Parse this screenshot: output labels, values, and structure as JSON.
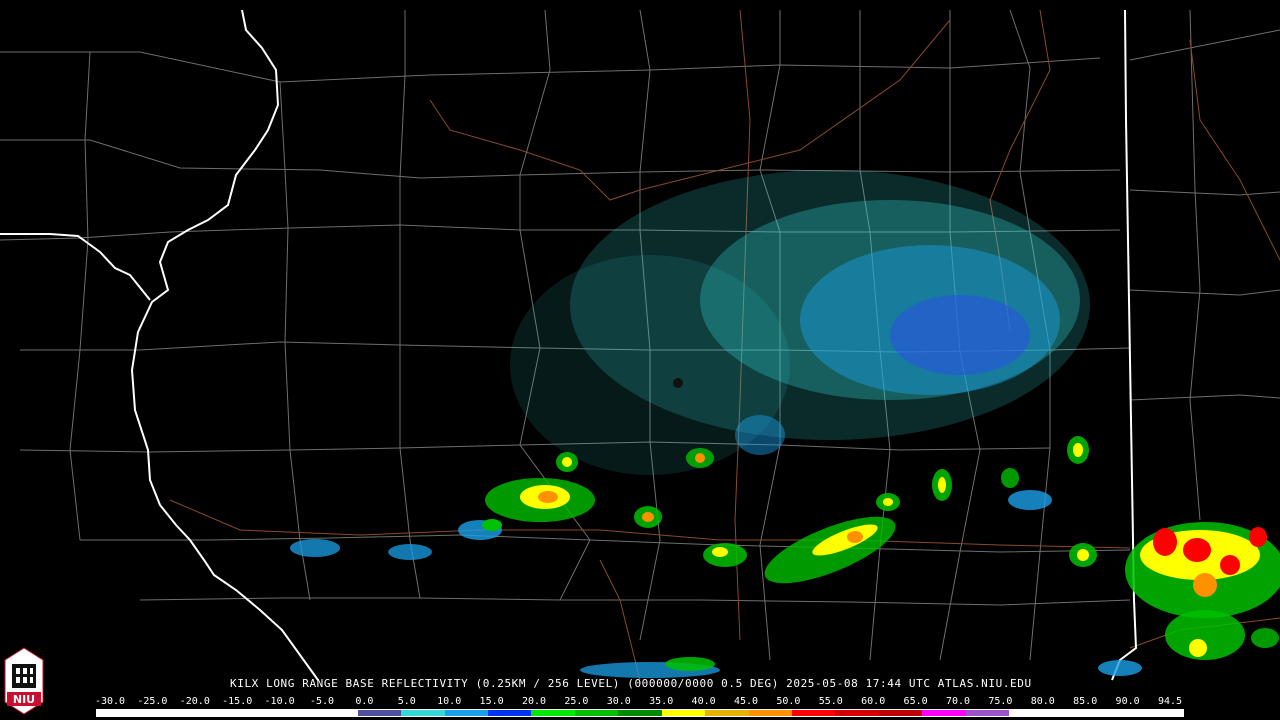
{
  "product": {
    "caption": "KILX LONG RANGE BASE REFLECTIVITY (0.25KM / 256 LEVEL) (000000/0000 0.5 DEG) 2025-05-08 17:44 UTC  ATLAS.NIU.EDU"
  },
  "logo": {
    "text": "NIU",
    "color": "#c8102e"
  },
  "legend": {
    "labels": [
      "-30.0",
      "-25.0",
      "-20.0",
      "-15.0",
      "-10.0",
      "-5.0",
      "0.0",
      "5.0",
      "10.0",
      "15.0",
      "20.0",
      "25.0",
      "30.0",
      "35.0",
      "40.0",
      "45.0",
      "50.0",
      "55.0",
      "60.0",
      "65.0",
      "70.0",
      "75.0",
      "80.0",
      "85.0",
      "90.0",
      "94.5"
    ],
    "colors": [
      "#ffffff",
      "#ffffff",
      "#ffffff",
      "#ffffff",
      "#ffffff",
      "#ffffff",
      "#4f4f9f",
      "#35d7d7",
      "#1aa0e8",
      "#0034f0",
      "#00e800",
      "#00c000",
      "#008a00",
      "#ffff00",
      "#e6b400",
      "#ff9000",
      "#ff0000",
      "#d20000",
      "#be0000",
      "#ff00ff",
      "#9a54c8",
      "#ffffff",
      "#ffffff",
      "#ffffff",
      "#ffffff"
    ]
  },
  "map": {
    "background": "#000000",
    "county_line_color": "#6e6e6e",
    "state_line_color": "#ffffff",
    "road_color": "#8b4a2b"
  }
}
